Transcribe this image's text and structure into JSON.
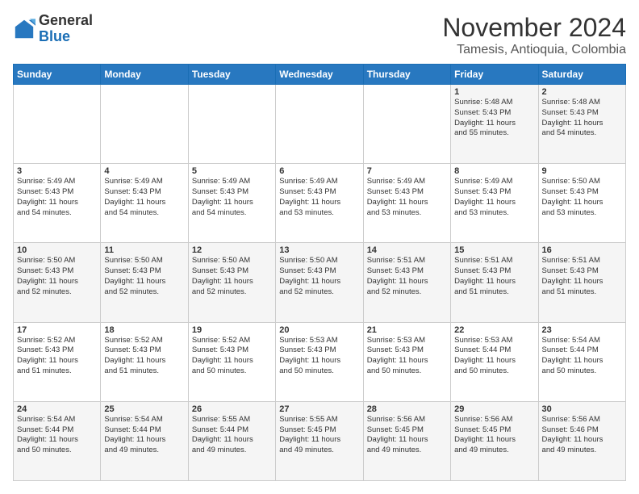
{
  "logo": {
    "general": "General",
    "blue": "Blue"
  },
  "header": {
    "month": "November 2024",
    "location": "Tamesis, Antioquia, Colombia"
  },
  "weekdays": [
    "Sunday",
    "Monday",
    "Tuesday",
    "Wednesday",
    "Thursday",
    "Friday",
    "Saturday"
  ],
  "weeks": [
    [
      {
        "day": "",
        "info": ""
      },
      {
        "day": "",
        "info": ""
      },
      {
        "day": "",
        "info": ""
      },
      {
        "day": "",
        "info": ""
      },
      {
        "day": "",
        "info": ""
      },
      {
        "day": "1",
        "info": "Sunrise: 5:48 AM\nSunset: 5:43 PM\nDaylight: 11 hours\nand 55 minutes."
      },
      {
        "day": "2",
        "info": "Sunrise: 5:48 AM\nSunset: 5:43 PM\nDaylight: 11 hours\nand 54 minutes."
      }
    ],
    [
      {
        "day": "3",
        "info": "Sunrise: 5:49 AM\nSunset: 5:43 PM\nDaylight: 11 hours\nand 54 minutes."
      },
      {
        "day": "4",
        "info": "Sunrise: 5:49 AM\nSunset: 5:43 PM\nDaylight: 11 hours\nand 54 minutes."
      },
      {
        "day": "5",
        "info": "Sunrise: 5:49 AM\nSunset: 5:43 PM\nDaylight: 11 hours\nand 54 minutes."
      },
      {
        "day": "6",
        "info": "Sunrise: 5:49 AM\nSunset: 5:43 PM\nDaylight: 11 hours\nand 53 minutes."
      },
      {
        "day": "7",
        "info": "Sunrise: 5:49 AM\nSunset: 5:43 PM\nDaylight: 11 hours\nand 53 minutes."
      },
      {
        "day": "8",
        "info": "Sunrise: 5:49 AM\nSunset: 5:43 PM\nDaylight: 11 hours\nand 53 minutes."
      },
      {
        "day": "9",
        "info": "Sunrise: 5:50 AM\nSunset: 5:43 PM\nDaylight: 11 hours\nand 53 minutes."
      }
    ],
    [
      {
        "day": "10",
        "info": "Sunrise: 5:50 AM\nSunset: 5:43 PM\nDaylight: 11 hours\nand 52 minutes."
      },
      {
        "day": "11",
        "info": "Sunrise: 5:50 AM\nSunset: 5:43 PM\nDaylight: 11 hours\nand 52 minutes."
      },
      {
        "day": "12",
        "info": "Sunrise: 5:50 AM\nSunset: 5:43 PM\nDaylight: 11 hours\nand 52 minutes."
      },
      {
        "day": "13",
        "info": "Sunrise: 5:50 AM\nSunset: 5:43 PM\nDaylight: 11 hours\nand 52 minutes."
      },
      {
        "day": "14",
        "info": "Sunrise: 5:51 AM\nSunset: 5:43 PM\nDaylight: 11 hours\nand 52 minutes."
      },
      {
        "day": "15",
        "info": "Sunrise: 5:51 AM\nSunset: 5:43 PM\nDaylight: 11 hours\nand 51 minutes."
      },
      {
        "day": "16",
        "info": "Sunrise: 5:51 AM\nSunset: 5:43 PM\nDaylight: 11 hours\nand 51 minutes."
      }
    ],
    [
      {
        "day": "17",
        "info": "Sunrise: 5:52 AM\nSunset: 5:43 PM\nDaylight: 11 hours\nand 51 minutes."
      },
      {
        "day": "18",
        "info": "Sunrise: 5:52 AM\nSunset: 5:43 PM\nDaylight: 11 hours\nand 51 minutes."
      },
      {
        "day": "19",
        "info": "Sunrise: 5:52 AM\nSunset: 5:43 PM\nDaylight: 11 hours\nand 50 minutes."
      },
      {
        "day": "20",
        "info": "Sunrise: 5:53 AM\nSunset: 5:43 PM\nDaylight: 11 hours\nand 50 minutes."
      },
      {
        "day": "21",
        "info": "Sunrise: 5:53 AM\nSunset: 5:43 PM\nDaylight: 11 hours\nand 50 minutes."
      },
      {
        "day": "22",
        "info": "Sunrise: 5:53 AM\nSunset: 5:44 PM\nDaylight: 11 hours\nand 50 minutes."
      },
      {
        "day": "23",
        "info": "Sunrise: 5:54 AM\nSunset: 5:44 PM\nDaylight: 11 hours\nand 50 minutes."
      }
    ],
    [
      {
        "day": "24",
        "info": "Sunrise: 5:54 AM\nSunset: 5:44 PM\nDaylight: 11 hours\nand 50 minutes."
      },
      {
        "day": "25",
        "info": "Sunrise: 5:54 AM\nSunset: 5:44 PM\nDaylight: 11 hours\nand 49 minutes."
      },
      {
        "day": "26",
        "info": "Sunrise: 5:55 AM\nSunset: 5:44 PM\nDaylight: 11 hours\nand 49 minutes."
      },
      {
        "day": "27",
        "info": "Sunrise: 5:55 AM\nSunset: 5:45 PM\nDaylight: 11 hours\nand 49 minutes."
      },
      {
        "day": "28",
        "info": "Sunrise: 5:56 AM\nSunset: 5:45 PM\nDaylight: 11 hours\nand 49 minutes."
      },
      {
        "day": "29",
        "info": "Sunrise: 5:56 AM\nSunset: 5:45 PM\nDaylight: 11 hours\nand 49 minutes."
      },
      {
        "day": "30",
        "info": "Sunrise: 5:56 AM\nSunset: 5:46 PM\nDaylight: 11 hours\nand 49 minutes."
      }
    ]
  ]
}
